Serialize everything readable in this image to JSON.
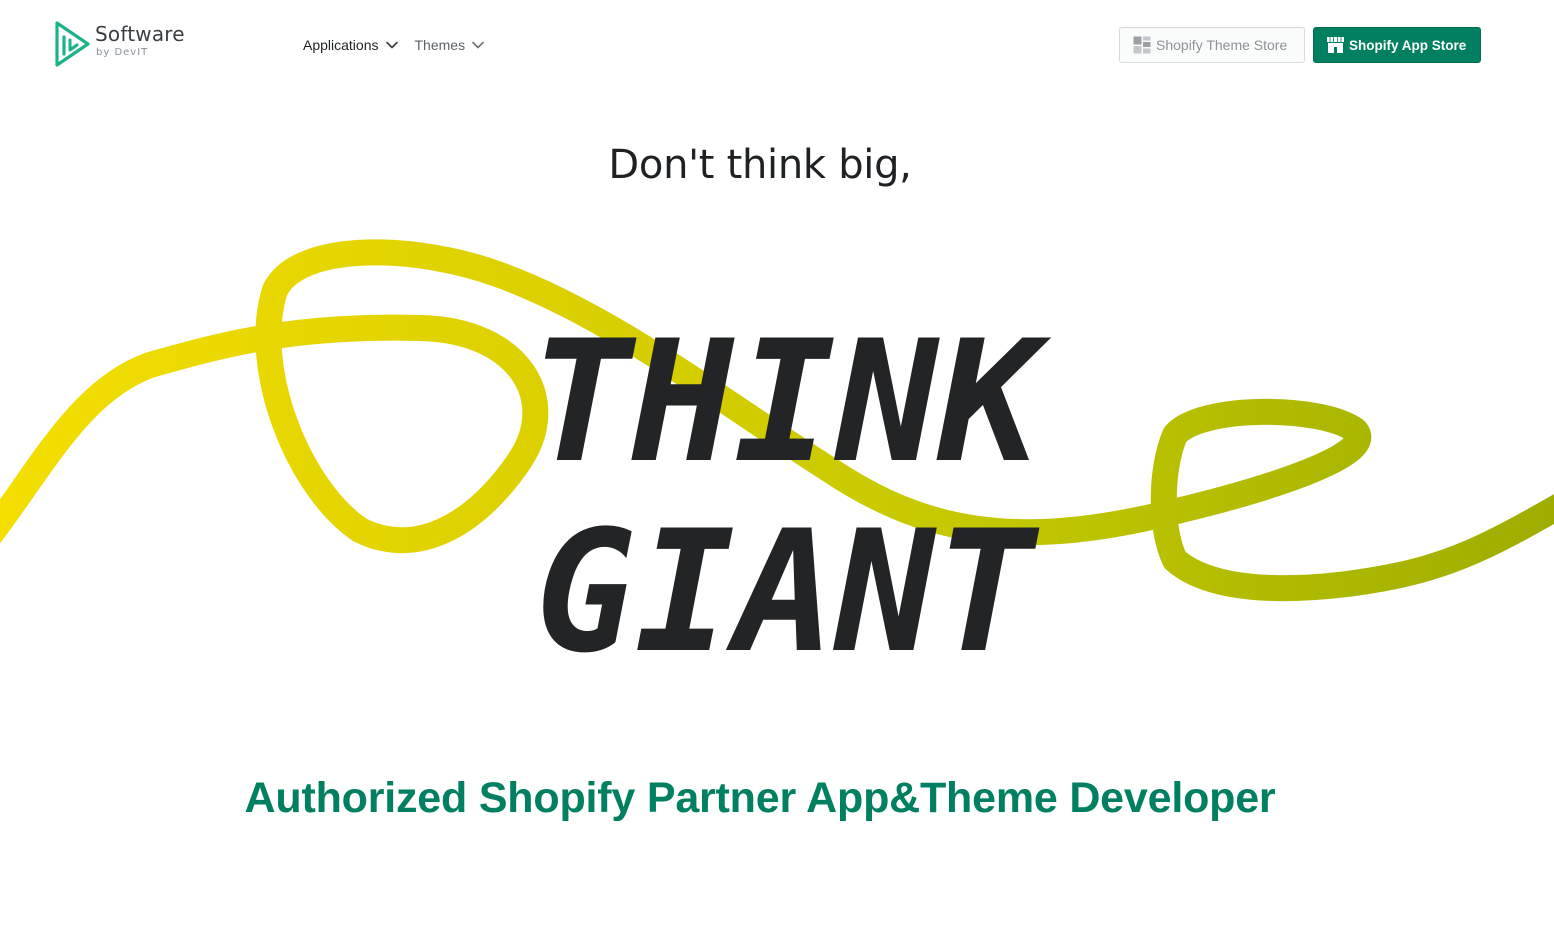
{
  "brand": {
    "name": "Software",
    "sub": "by DevIT",
    "accent": "#1db38a"
  },
  "nav": {
    "items": [
      {
        "label": "Applications",
        "icon": "chevron-down-icon"
      },
      {
        "label": "Themes",
        "icon": "chevron-down-icon"
      }
    ]
  },
  "header_buttons": {
    "theme_store": {
      "label": "Shopify Theme Store",
      "icon": "theme-store-icon"
    },
    "app_store": {
      "label": "Shopify App Store",
      "icon": "storefront-icon",
      "color": "#008060"
    }
  },
  "hero": {
    "tagline": "Don't think big,",
    "line1": "THINK",
    "line2": "GIANT",
    "ribbon_colors": [
      "#f2dc00",
      "#c8cc00",
      "#9fad00"
    ]
  },
  "partner_text": "Authorized Shopify Partner App&Theme Developer",
  "partner_color": "#008060"
}
